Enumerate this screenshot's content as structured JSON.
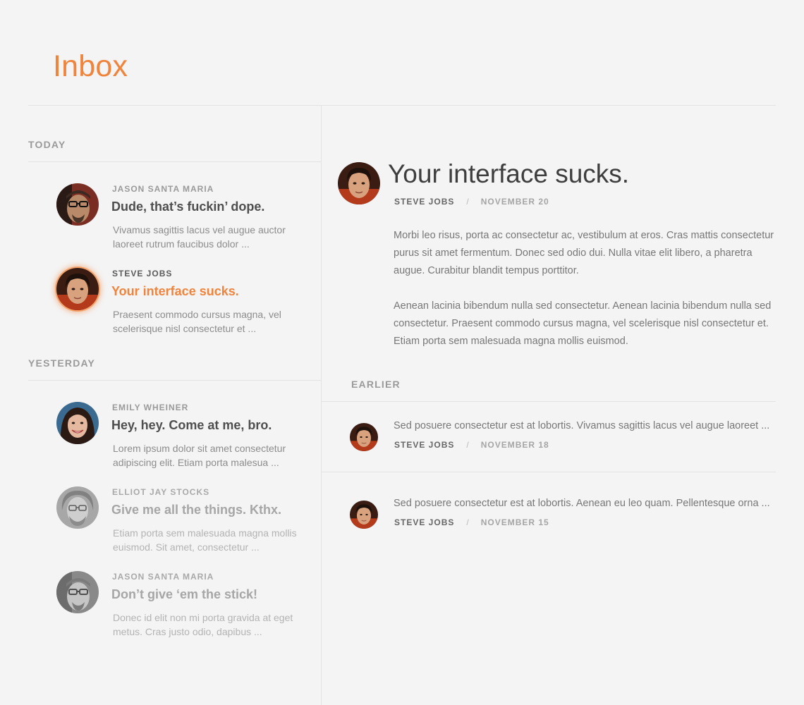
{
  "header": {
    "title": "Inbox"
  },
  "colors": {
    "accent": "#f0843c",
    "background": "#f4f4f4"
  },
  "sections": {
    "today": "TODAY",
    "yesterday": "YESTERDAY",
    "earlier": "EARLIER"
  },
  "messages": [
    {
      "sender": "JASON SANTA MARIA",
      "subject": "Dude, that’s fuckin’ dope.",
      "preview": "Vivamus sagittis lacus vel augue auctor laoreet rutrum faucibus dolor  ...",
      "state": "unread"
    },
    {
      "sender": "STEVE JOBS",
      "subject": "Your interface sucks.",
      "preview": "Praesent commodo cursus magna, vel scelerisque nisl consectetur et ...",
      "state": "active"
    },
    {
      "sender": "EMILY WHEINER",
      "subject": "Hey, hey. Come at me, bro.",
      "preview": "Lorem ipsum dolor sit amet consectetur adipiscing elit. Etiam porta malesua ...",
      "state": "unread"
    },
    {
      "sender": "ELLIOT JAY STOCKS",
      "subject": "Give me all the things. Kthx.",
      "preview": "Etiam porta sem malesuada magna mollis euismod. Sit amet, consectetur ...",
      "state": "read"
    },
    {
      "sender": "JASON SANTA MARIA",
      "subject": "Don’t give ‘em the stick!",
      "preview": "Donec id elit non mi porta gravida at eget metus. Cras justo odio, dapibus ...",
      "state": "read"
    }
  ],
  "detail": {
    "subject": "Your interface sucks.",
    "sender": "STEVE JOBS",
    "separator": "/",
    "date": "NOVEMBER 20",
    "paragraphs": [
      "Morbi leo risus, porta ac consectetur ac, vestibulum at eros. Cras mattis consectetur purus sit amet fermentum. Donec sed odio dui. Nulla vitae elit libero, a pharetra augue. Curabitur blandit tempus porttitor.",
      "Aenean lacinia bibendum nulla sed consectetur. Aenean lacinia bibendum nulla sed consectetur. Praesent commodo cursus magna, vel scelerisque nisl consectetur et. Etiam porta sem malesuada magna mollis euismod."
    ]
  },
  "earlier": [
    {
      "snippet": "Sed posuere consectetur est at lobortis. Vivamus sagittis lacus vel augue laoreet ...",
      "sender": "STEVE JOBS",
      "separator": "/",
      "date": "NOVEMBER 18"
    },
    {
      "snippet": "Sed posuere consectetur est at lobortis. Aenean eu leo quam. Pellentesque orna ...",
      "sender": "STEVE JOBS",
      "separator": "/",
      "date": "NOVEMBER 15"
    }
  ]
}
